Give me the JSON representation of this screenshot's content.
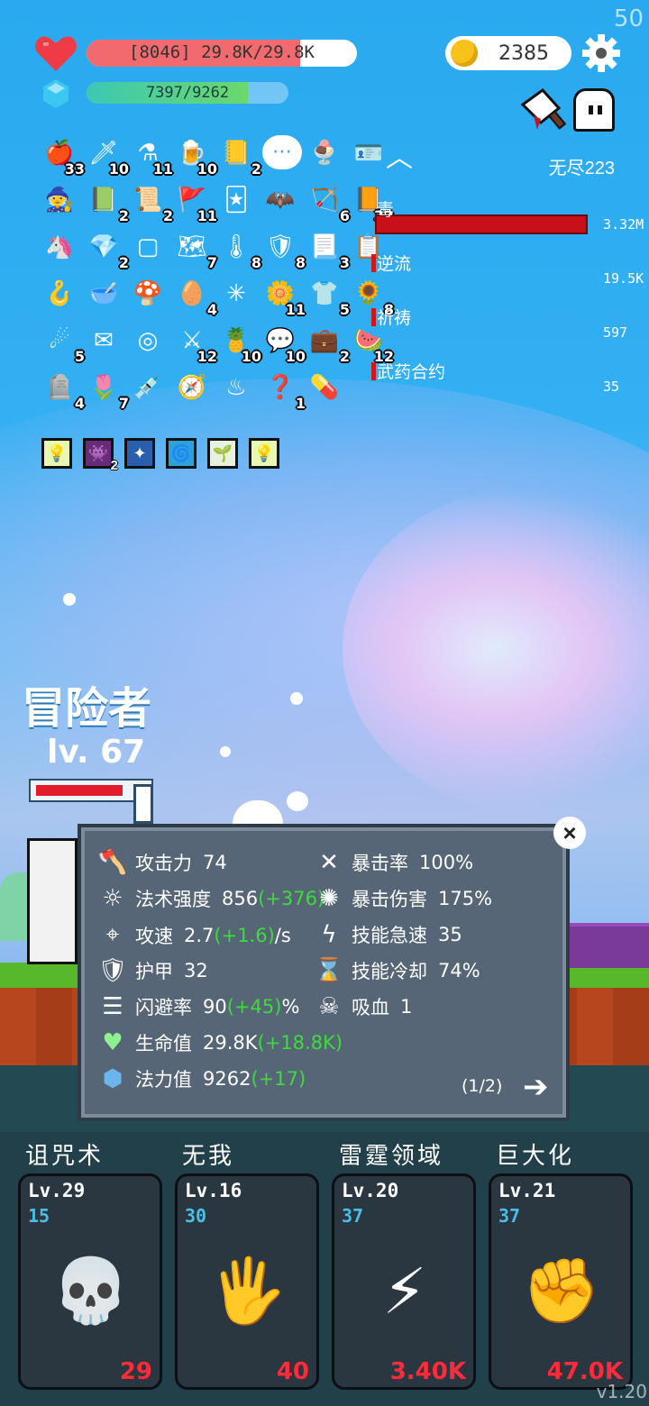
{
  "fps": "50",
  "hp": {
    "text": "[8046] 29.8K/29.8K",
    "fraction": 0.79
  },
  "mp": {
    "text": "7397/9262",
    "fraction": 0.8
  },
  "gold": "2385",
  "mode": "无尽223",
  "items": [
    {
      "icon": "apple-icon",
      "glyph": "🍎",
      "count": "33"
    },
    {
      "icon": "dagger-icon",
      "glyph": "🗡",
      "count": "10"
    },
    {
      "icon": "flask-icon",
      "glyph": "⚗",
      "count": "11"
    },
    {
      "icon": "beer-icon",
      "glyph": "🍺",
      "count": "10"
    },
    {
      "icon": "note-icon",
      "glyph": "📒",
      "count": "2"
    },
    {
      "icon": "speech-bubble-icon",
      "glyph": "⋯",
      "count": ""
    },
    {
      "icon": "ice-cream-icon",
      "glyph": "🍨",
      "count": ""
    },
    {
      "icon": "id-card-icon",
      "glyph": "🪪",
      "count": ""
    },
    {
      "icon": "wizard-hat-icon",
      "glyph": "🧙",
      "count": ""
    },
    {
      "icon": "green-book-icon",
      "glyph": "📗",
      "count": "2"
    },
    {
      "icon": "scroll-icon",
      "glyph": "📜",
      "count": "2"
    },
    {
      "icon": "red-flag-icon",
      "glyph": "🚩",
      "count": "11"
    },
    {
      "icon": "playing-cards-icon",
      "glyph": "🃏",
      "count": ""
    },
    {
      "icon": "bat-icon",
      "glyph": "🦇",
      "count": ""
    },
    {
      "icon": "bow-icon",
      "glyph": "🏹",
      "count": "6"
    },
    {
      "icon": "orange-book-icon",
      "glyph": "📙",
      "count": "32"
    },
    {
      "icon": "unicorn-icon",
      "glyph": "🦄",
      "count": ""
    },
    {
      "icon": "ruby-icon",
      "glyph": "💎",
      "count": "2"
    },
    {
      "icon": "empty-slot-icon",
      "glyph": "▢",
      "count": ""
    },
    {
      "icon": "map-icon",
      "glyph": "🗺",
      "count": "7"
    },
    {
      "icon": "thermometer-icon",
      "glyph": "🌡",
      "count": "8"
    },
    {
      "icon": "shield-round-icon",
      "glyph": "🛡",
      "count": "8"
    },
    {
      "icon": "parchment-icon",
      "glyph": "📃",
      "count": "3"
    },
    {
      "icon": "checklist-icon",
      "glyph": "📋",
      "count": ""
    },
    {
      "icon": "hook-icon",
      "glyph": "🪝",
      "count": ""
    },
    {
      "icon": "mortar-icon",
      "glyph": "🥣",
      "count": ""
    },
    {
      "icon": "mushroom-icon",
      "glyph": "🍄",
      "count": ""
    },
    {
      "icon": "pinecone-icon",
      "glyph": "🥚",
      "count": "4"
    },
    {
      "icon": "molecule-icon",
      "glyph": "✳",
      "count": ""
    },
    {
      "icon": "daisy-icon",
      "glyph": "🌼",
      "count": "11"
    },
    {
      "icon": "shirt-icon",
      "glyph": "👕",
      "count": "5"
    },
    {
      "icon": "sunflower-icon",
      "glyph": "🌻",
      "count": "8"
    },
    {
      "icon": "meteor-icon",
      "glyph": "☄",
      "count": "5"
    },
    {
      "icon": "envelope-icon",
      "glyph": "✉",
      "count": ""
    },
    {
      "icon": "target-icon",
      "glyph": "◎",
      "count": ""
    },
    {
      "icon": "sword-icon",
      "glyph": "⚔",
      "count": "12"
    },
    {
      "icon": "pineapple-icon",
      "glyph": "🍍",
      "count": "10"
    },
    {
      "icon": "chat-bubble-icon",
      "glyph": "💬",
      "count": "10"
    },
    {
      "icon": "briefcase-icon",
      "glyph": "💼",
      "count": "2"
    },
    {
      "icon": "watermelon-icon",
      "glyph": "🍉",
      "count": "12"
    },
    {
      "icon": "tombstone-icon",
      "glyph": "🪦",
      "count": "4"
    },
    {
      "icon": "potted-flower-icon",
      "glyph": "🌷",
      "count": "7"
    },
    {
      "icon": "syringe-icon",
      "glyph": "💉",
      "count": ""
    },
    {
      "icon": "compass-icon",
      "glyph": "🧭",
      "count": ""
    },
    {
      "icon": "heat-waves-icon",
      "glyph": "♨",
      "count": ""
    },
    {
      "icon": "mystery-map-icon",
      "glyph": "❓",
      "count": "1"
    },
    {
      "icon": "pill-icon",
      "glyph": "💊",
      "count": ""
    }
  ],
  "buffs": [
    {
      "icon": "lamp-buff-icon",
      "glyph": "💡",
      "count": "",
      "color": "#eaf7b0"
    },
    {
      "icon": "demon-buff-icon",
      "glyph": "👾",
      "count": "2",
      "color": "#6a2a7a"
    },
    {
      "icon": "star-burst-buff-icon",
      "glyph": "✦",
      "count": "",
      "color": "#2a5fae"
    },
    {
      "icon": "vortex-buff-icon",
      "glyph": "🌀",
      "count": "",
      "color": "#2ea2d8"
    },
    {
      "icon": "sprout-buff-icon",
      "glyph": "🌱",
      "count": "",
      "color": "#e8f0e0"
    },
    {
      "icon": "lamp-buff-2-icon",
      "glyph": "💡",
      "count": "",
      "color": "#eaf7b0"
    }
  ],
  "boss_stats": [
    {
      "label": "毒",
      "value": "3.32M"
    },
    {
      "label": "逆流",
      "value": "19.5K"
    },
    {
      "label": "祈祷",
      "value": "597"
    },
    {
      "label": "武药合约",
      "value": "35"
    }
  ],
  "hero": {
    "name": "冒险者",
    "level": "lv. 67"
  },
  "stats_left": [
    {
      "icon": "axe-icon",
      "glyph": "🪓",
      "label": "攻击力",
      "value": "74",
      "bonus": "",
      "suffix": ""
    },
    {
      "icon": "sun-icon",
      "glyph": "☼",
      "label": "法术强度",
      "value": "856",
      "bonus": "(+376)",
      "suffix": ""
    },
    {
      "icon": "crosshair-bow-icon",
      "glyph": "⌖",
      "label": "攻速",
      "value": "2.7",
      "bonus": "(+1.6)",
      "suffix": "/s"
    },
    {
      "icon": "shield-icon",
      "glyph": "🛡",
      "label": "护甲",
      "value": "32",
      "bonus": "",
      "suffix": ""
    },
    {
      "icon": "dodge-lines-icon",
      "glyph": "☰",
      "label": "闪避率",
      "value": "90",
      "bonus": "(+45)",
      "suffix": "%"
    },
    {
      "icon": "heart-icon",
      "glyph": "♥",
      "label": "生命值",
      "value": "29.8K",
      "bonus": "(+18.8K)",
      "suffix": ""
    },
    {
      "icon": "mana-gem-icon",
      "glyph": "⬢",
      "label": "法力值",
      "value": "9262",
      "bonus": "(+17)",
      "suffix": ""
    }
  ],
  "stats_right": [
    {
      "icon": "crit-rate-icon",
      "glyph": "✕",
      "label": "暴击率",
      "value": "100%"
    },
    {
      "icon": "crit-damage-icon",
      "glyph": "✺",
      "label": "暴击伤害",
      "value": "175%"
    },
    {
      "icon": "lightning-icon",
      "glyph": "ϟ",
      "label": "技能急速",
      "value": "35"
    },
    {
      "icon": "hourglass-icon",
      "glyph": "⌛",
      "label": "技能冷却",
      "value": "74%"
    },
    {
      "icon": "lifesteal-skull-icon",
      "glyph": "☠",
      "label": "吸血",
      "value": "1"
    }
  ],
  "pager": "(1/2)",
  "skills": [
    {
      "name": "诅咒术",
      "level": "Lv.29",
      "cost": "15",
      "price": "29",
      "icon": "skull-icon",
      "glyph": "💀"
    },
    {
      "name": "无我",
      "level": "Lv.16",
      "cost": "30",
      "price": "40",
      "icon": "eye-hand-icon",
      "glyph": "🖐"
    },
    {
      "name": "雷霆领域",
      "level": "Lv.20",
      "cost": "37",
      "price": "3.40K",
      "icon": "thunder-mine-icon",
      "glyph": "⚡"
    },
    {
      "name": "巨大化",
      "level": "Lv.21",
      "cost": "37",
      "price": "47.0K",
      "icon": "fist-icon",
      "glyph": "✊"
    }
  ],
  "version": "v1.20"
}
